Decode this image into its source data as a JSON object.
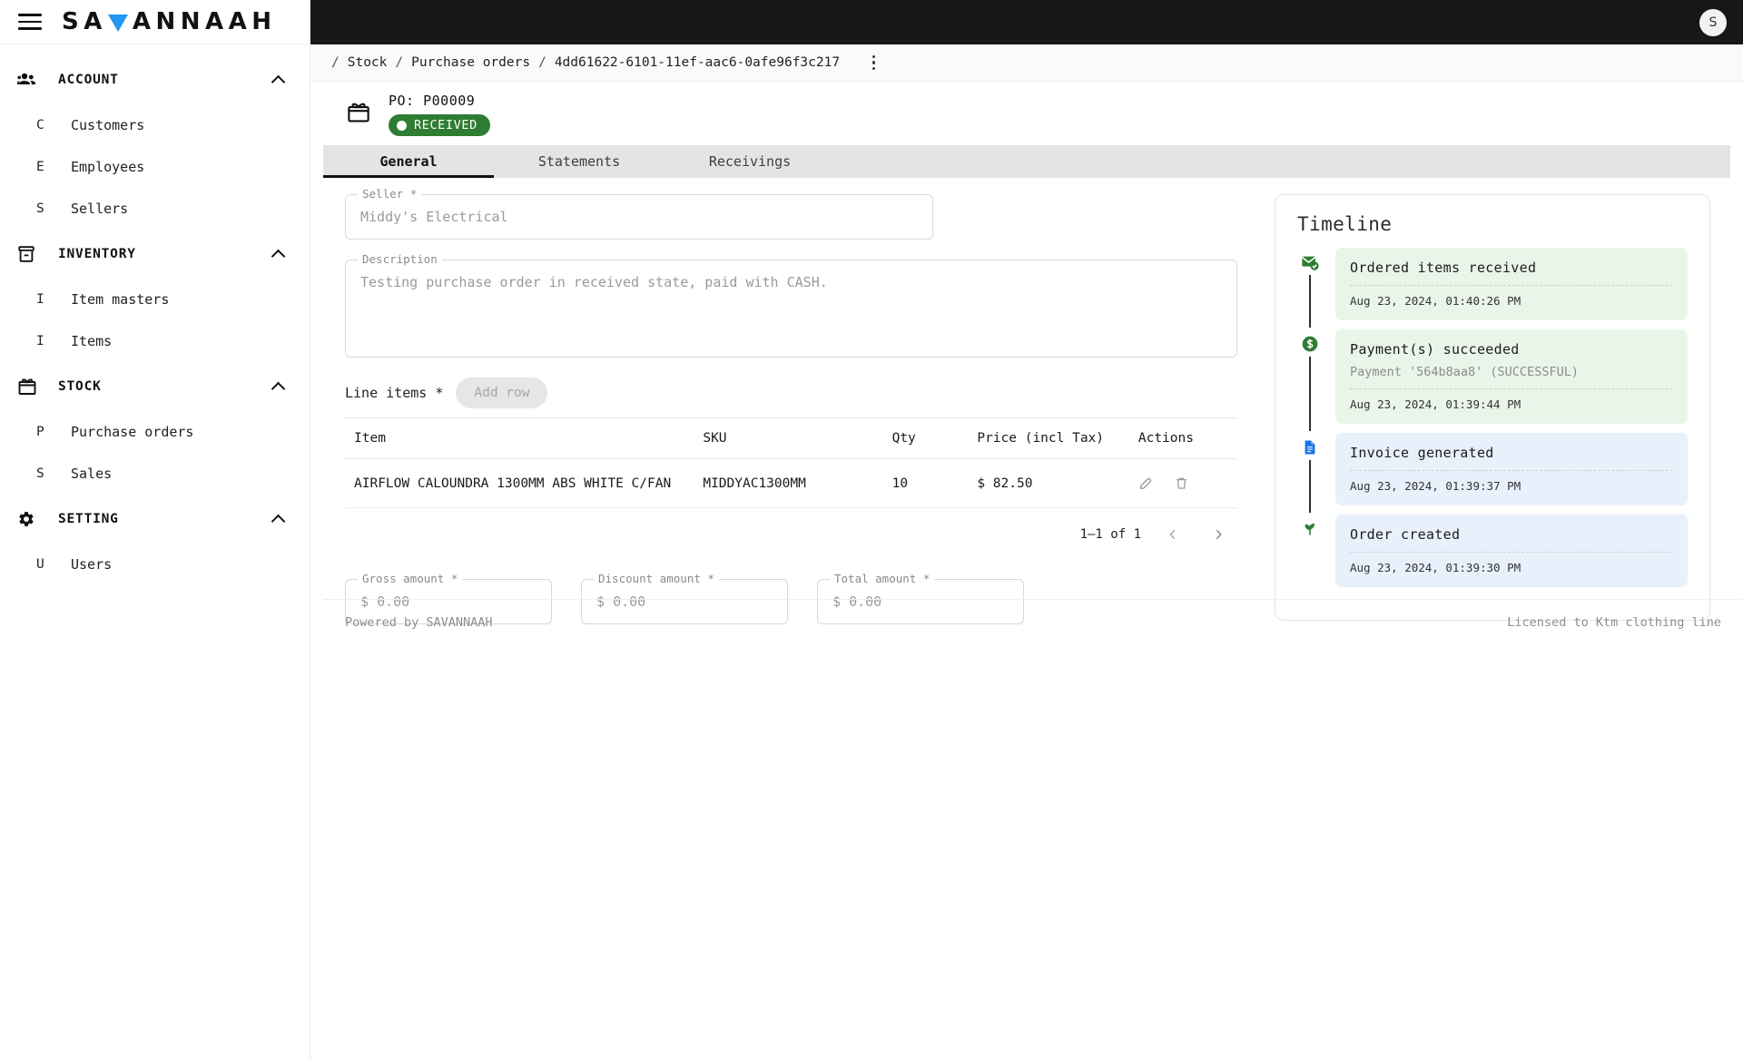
{
  "brand": {
    "logo_text_a": "SA",
    "logo_text_b": "ANNAAH",
    "logo_icon": "triangle-logo-mark",
    "accent": "#2196f3"
  },
  "topbar": {
    "avatar_initial": "S",
    "background": "#171717"
  },
  "sidebar": {
    "groups": [
      {
        "label": "ACCOUNT",
        "icon": "people-icon",
        "items": [
          {
            "letter": "C",
            "label": "Customers"
          },
          {
            "letter": "E",
            "label": "Employees"
          },
          {
            "letter": "S",
            "label": "Sellers"
          }
        ]
      },
      {
        "label": "INVENTORY",
        "icon": "inventory-box-icon",
        "items": [
          {
            "letter": "I",
            "label": "Item masters"
          },
          {
            "letter": "I",
            "label": "Items"
          }
        ]
      },
      {
        "label": "STOCK",
        "icon": "gift-box-icon",
        "items": [
          {
            "letter": "P",
            "label": "Purchase orders"
          },
          {
            "letter": "S",
            "label": "Sales"
          }
        ]
      },
      {
        "label": "SETTING",
        "icon": "gear-icon",
        "items": [
          {
            "letter": "U",
            "label": "Users"
          }
        ]
      }
    ]
  },
  "breadcrumb": {
    "sep": "/",
    "items": [
      "Stock",
      "Purchase orders",
      "4dd61622-6101-11ef-aac6-0afe96f3c217"
    ],
    "menu_icon": "kebab-menu-icon"
  },
  "order_header": {
    "icon": "purchase-order-icon",
    "title": "PO: P00009",
    "status_label": "RECEIVED",
    "status_color": "#2e7d32"
  },
  "tabs": [
    {
      "label": "General",
      "active": true
    },
    {
      "label": "Statements",
      "active": false
    },
    {
      "label": "Receivings",
      "active": false
    }
  ],
  "form": {
    "seller": {
      "label": "Seller *",
      "value": "Middy's Electrical"
    },
    "description": {
      "label": "Description",
      "value": "Testing purchase order in received state, paid with CASH."
    },
    "line_items_label": "Line items *",
    "add_row_label": "Add row",
    "gross_amount": {
      "label": "Gross amount *",
      "prefix": "$",
      "value": "0.00"
    },
    "discount_amount": {
      "label": "Discount amount *",
      "prefix": "$",
      "value": "0.00"
    },
    "total_amount": {
      "label": "Total amount *",
      "prefix": "$",
      "value": "0.00"
    }
  },
  "line_items_table": {
    "columns": [
      "Item",
      "SKU",
      "Qty",
      "Price (incl Tax)",
      "Actions"
    ],
    "rows": [
      {
        "item": "AIRFLOW CALOUNDRA 1300MM ABS WHITE C/FAN",
        "sku": "MIDDYAC1300MM",
        "qty": "10",
        "price": "$ 82.50",
        "actions": [
          "edit-icon",
          "delete-icon"
        ]
      }
    ],
    "pagination": {
      "range": "1–1 of 1",
      "prev_icon": "chevron-left-icon",
      "next_icon": "chevron-right-icon"
    }
  },
  "timeline": {
    "title": "Timeline",
    "entries": [
      {
        "icon": "mail-check-icon",
        "tone": "green",
        "title": "Ordered items received",
        "detail": "",
        "date": "Aug 23, 2024, 01:40:26 PM"
      },
      {
        "icon": "dollar-circle-icon",
        "tone": "green",
        "title": "Payment(s) succeeded",
        "detail": "Payment '564b8aa8' (SUCCESSFUL)",
        "date": "Aug 23, 2024, 01:39:44 PM"
      },
      {
        "icon": "invoice-document-icon",
        "tone": "blue",
        "title": "Invoice generated",
        "detail": "",
        "date": "Aug 23, 2024, 01:39:37 PM"
      },
      {
        "icon": "sprout-icon",
        "tone": "blue",
        "title": "Order created",
        "detail": "",
        "date": "Aug 23, 2024, 01:39:30 PM"
      }
    ]
  },
  "footer": {
    "left": "Powered by SAVANNAAH",
    "right": "Licensed to Ktm clothing line"
  }
}
